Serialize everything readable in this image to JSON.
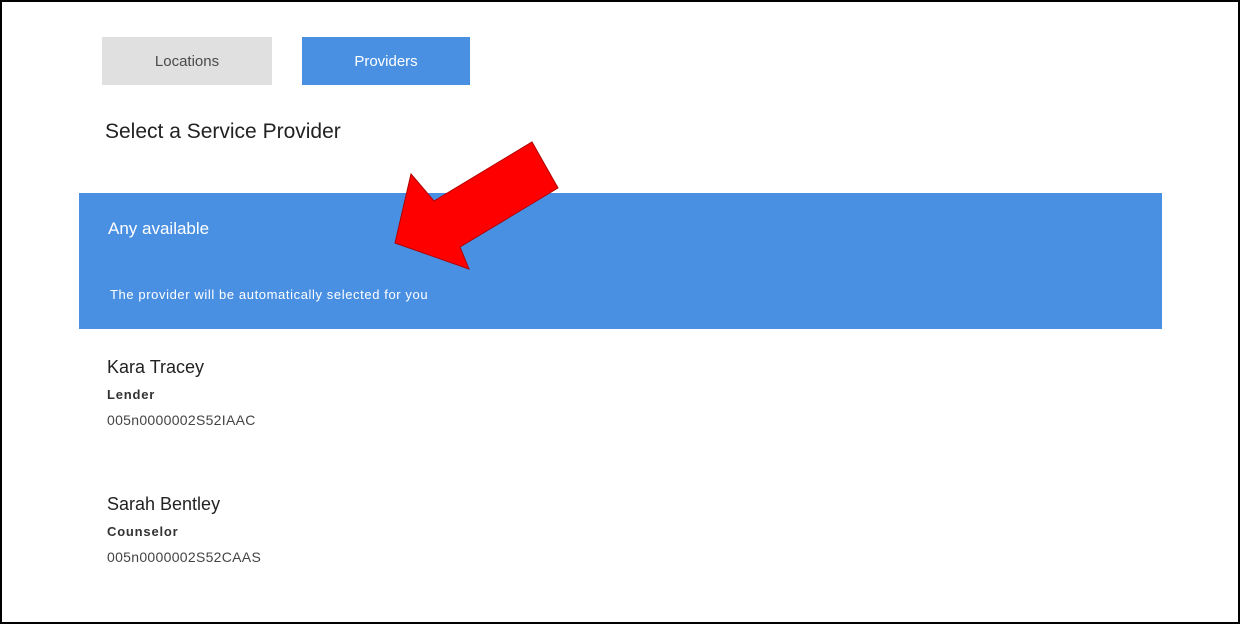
{
  "tabs": [
    {
      "label": "Locations",
      "active": false
    },
    {
      "label": "Providers",
      "active": true
    }
  ],
  "page": {
    "title": "Select a Service Provider"
  },
  "providers": [
    {
      "name": "Any available",
      "description": "The provider will be automatically selected for you",
      "selected": true
    },
    {
      "name": "Kara Tracey",
      "role": "Lender",
      "id": "005n0000002S52IAAC",
      "selected": false
    },
    {
      "name": "Sarah Bentley",
      "role": "Counselor",
      "id": "005n0000002S52CAAS",
      "selected": false
    }
  ],
  "colors": {
    "accent": "#4a90e2",
    "inactive_tab": "#e0e0e0",
    "annotation_arrow": "#ff0000",
    "frame_border": "#000000"
  },
  "icons": {
    "annotation": "red-arrow-icon"
  }
}
